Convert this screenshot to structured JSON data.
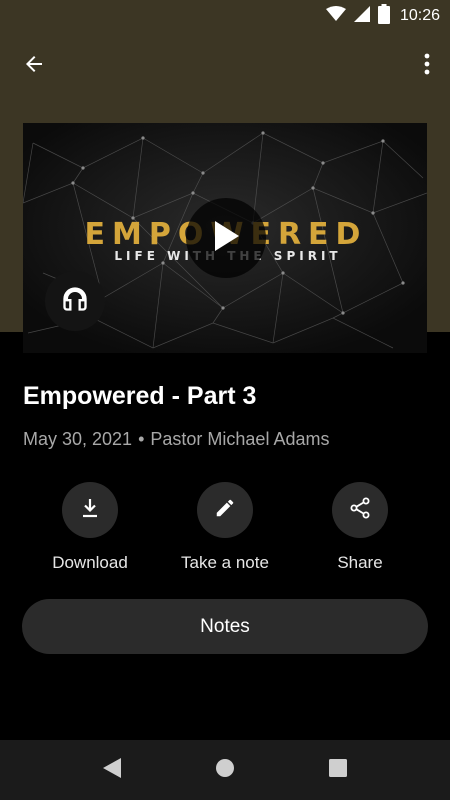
{
  "status_bar": {
    "time": "10:26",
    "icons": [
      "wifi-icon",
      "cell-signal-icon",
      "battery-icon"
    ]
  },
  "app_bar": {
    "back_icon": "arrow-left-icon",
    "more_icon": "more-vertical-icon"
  },
  "media": {
    "thumbnail_title": "EMPOWERED",
    "thumbnail_subtitle": "LIFE WITH THE SPIRIT",
    "play_icon": "play-icon",
    "audio_icon": "headphones-icon"
  },
  "sermon": {
    "title": "Empowered - Part 3",
    "date": "May 30, 2021",
    "separator": "•",
    "speaker": "Pastor Michael Adams"
  },
  "actions": [
    {
      "label": "Download",
      "icon": "download-icon"
    },
    {
      "label": "Take a note",
      "icon": "pencil-icon"
    },
    {
      "label": "Share",
      "icon": "share-icon"
    }
  ],
  "notes_button": {
    "label": "Notes"
  },
  "nav_bar": {
    "icons": [
      "back-triangle-icon",
      "home-circle-icon",
      "recents-square-icon"
    ]
  },
  "colors": {
    "header_bg": "#3c3624",
    "accent_gold": "#d4a53a",
    "button_bg": "#2b2b2b",
    "page_bg": "#000000"
  }
}
